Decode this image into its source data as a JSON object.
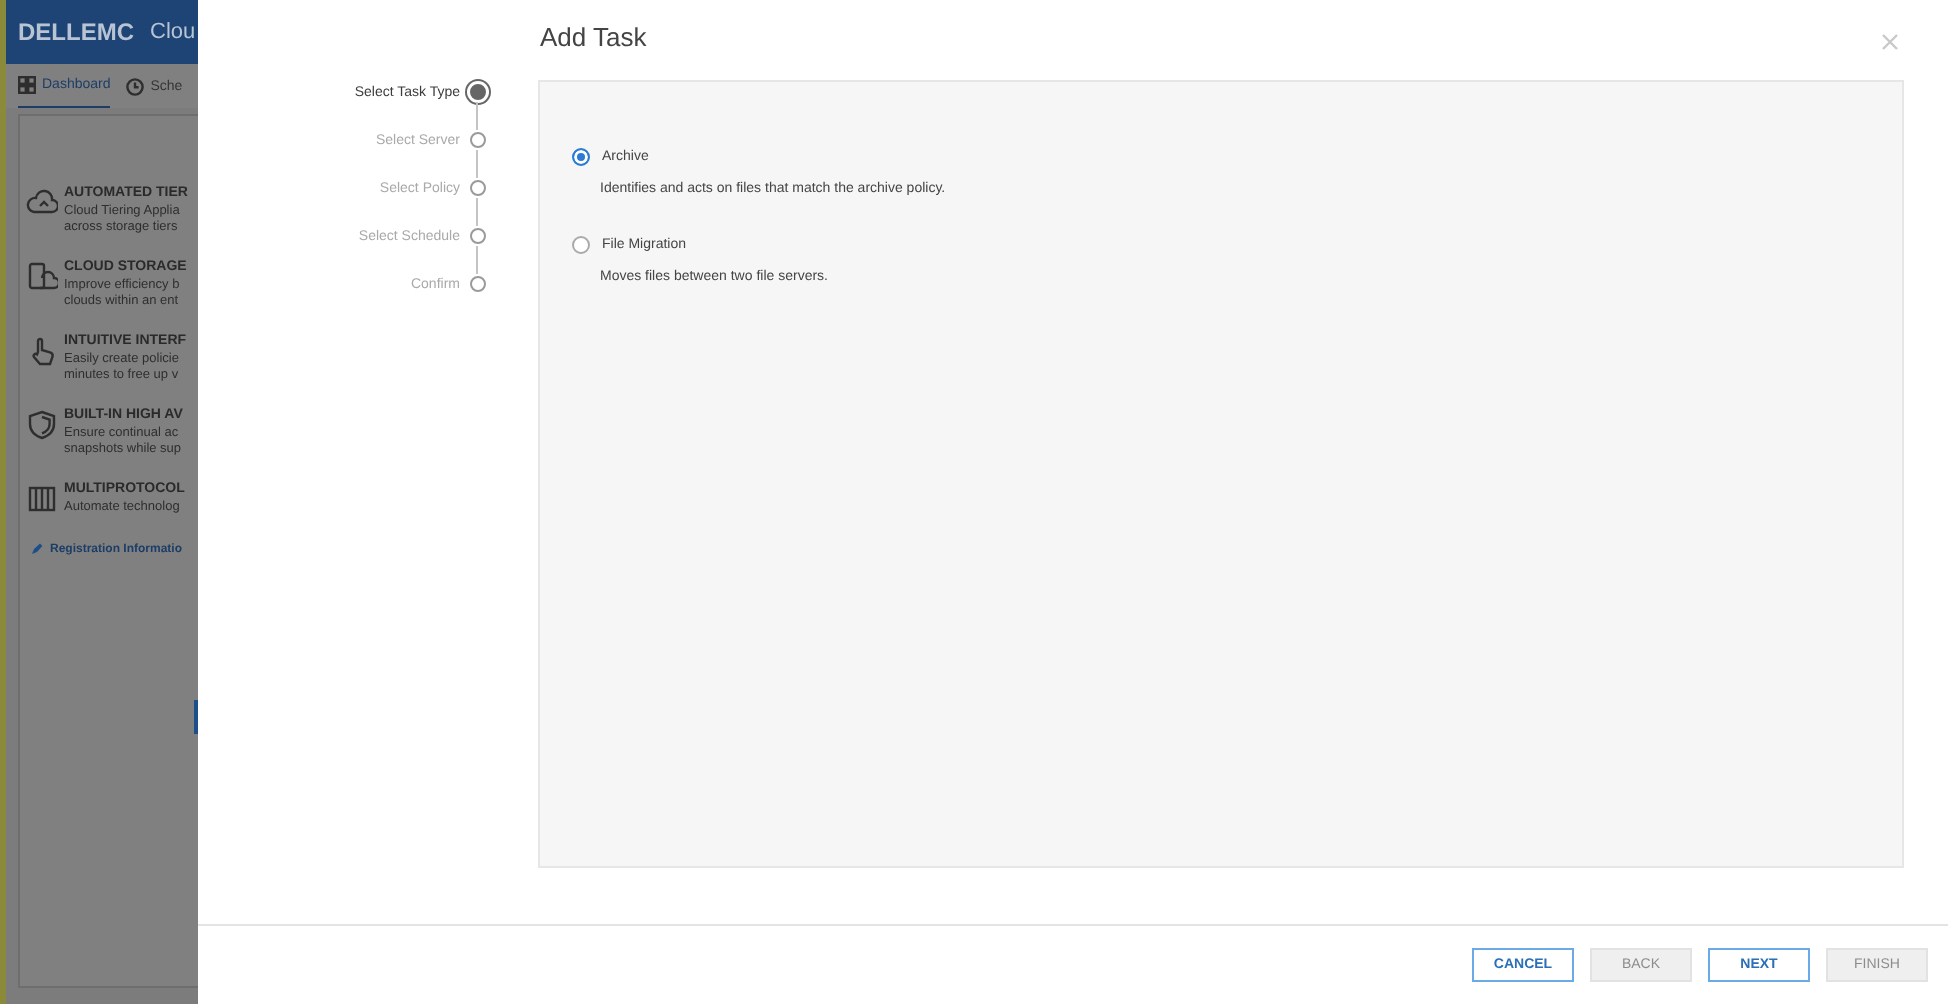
{
  "background_app": {
    "logo": "DELLEMC",
    "title": "Clou",
    "tabs": [
      {
        "label": "Dashboard",
        "selected": true
      },
      {
        "label": "Sche",
        "selected": false
      }
    ],
    "features": [
      {
        "title": "AUTOMATED TIER",
        "lines": [
          "Cloud Tiering Applia",
          "across storage tiers"
        ]
      },
      {
        "title": "CLOUD STORAGE",
        "lines": [
          "Improve efficiency b",
          "clouds within an ent"
        ]
      },
      {
        "title": "INTUITIVE INTERF",
        "lines": [
          "Easily create policie",
          "minutes to free up v"
        ]
      },
      {
        "title": "BUILT-IN HIGH AV",
        "lines": [
          "Ensure continual ac",
          "snapshots while sup"
        ]
      },
      {
        "title": "MULTIPROTOCOL",
        "lines": [
          "Automate technolog"
        ]
      }
    ],
    "link": "Registration Informatio"
  },
  "dialog": {
    "title": "Add Task",
    "steps": [
      {
        "label": "Select Task Type",
        "selected": true
      },
      {
        "label": "Select Server",
        "selected": false
      },
      {
        "label": "Select Policy",
        "selected": false
      },
      {
        "label": "Select Schedule",
        "selected": false
      },
      {
        "label": "Confirm",
        "selected": false
      }
    ],
    "options": [
      {
        "label": "Archive",
        "description": "Identifies and acts on files that match the archive policy.",
        "selected": true
      },
      {
        "label": "File Migration",
        "description": "Moves files between two file servers.",
        "selected": false
      }
    ],
    "buttons": [
      {
        "label": "CANCEL",
        "disabled": false
      },
      {
        "label": "BACK",
        "disabled": true
      },
      {
        "label": "NEXT",
        "disabled": false
      },
      {
        "label": "FINISH",
        "disabled": true
      }
    ]
  }
}
